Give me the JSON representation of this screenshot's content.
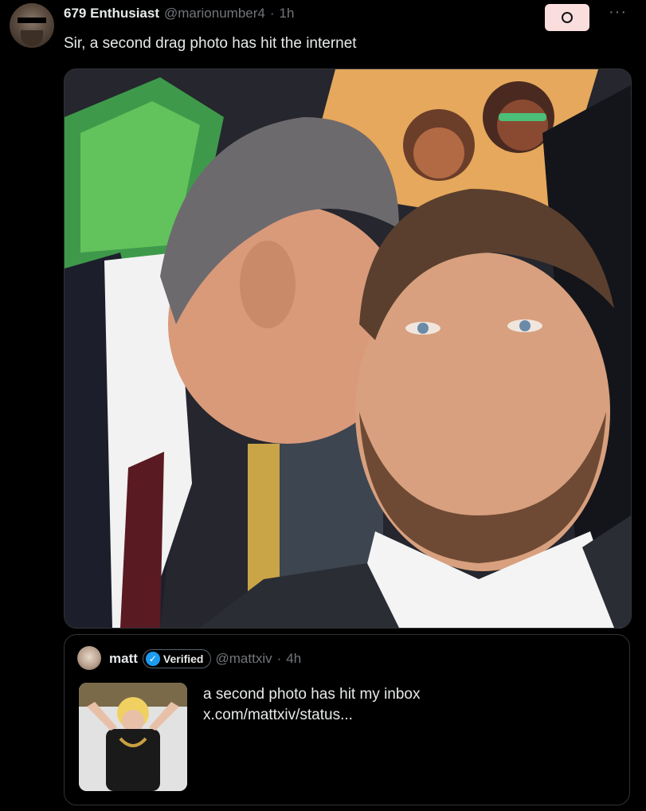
{
  "post": {
    "display_name": "679 Enthusiast",
    "handle": "@marionumber4",
    "separator": "·",
    "time": "1h",
    "text": "Sir, a second drag photo has hit the internet",
    "more_label": "···"
  },
  "quoted_post": {
    "display_name": "matt",
    "verified_label": "Verified",
    "handle": "@mattxiv",
    "separator": "·",
    "time": "4h",
    "text": "a second photo has hit my inbox",
    "link": "x.com/mattxiv/status..."
  },
  "colors": {
    "background": "#000000",
    "text_primary": "#e7e9ea",
    "text_secondary": "#71767b",
    "verified_blue": "#1d9bf0",
    "grok_button_bg": "#fadede",
    "border": "#2f3336"
  },
  "icons": {
    "grok_button": "circle-icon",
    "more": "ellipsis-icon",
    "verified": "checkmark-icon"
  }
}
